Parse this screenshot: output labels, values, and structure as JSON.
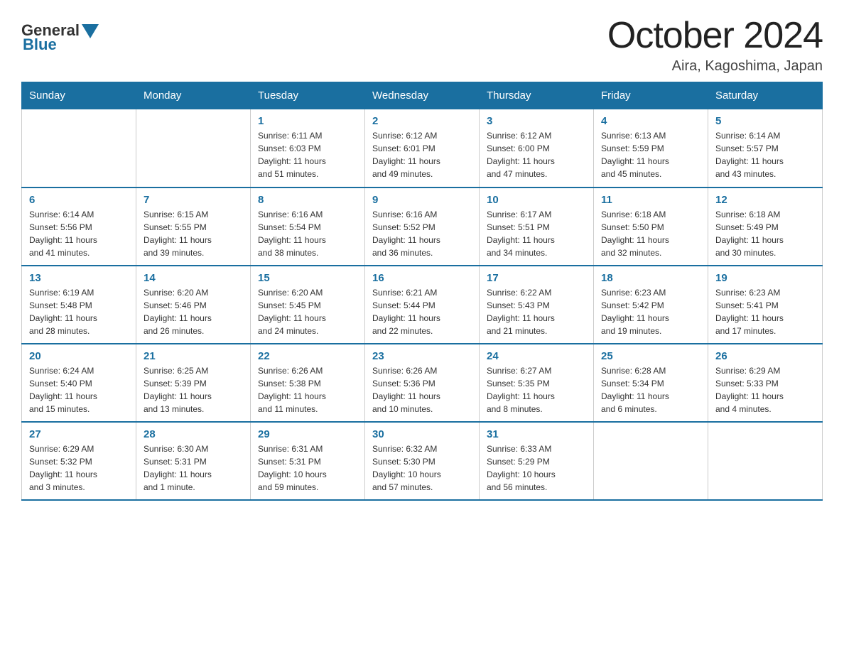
{
  "logo": {
    "general": "General",
    "blue": "Blue"
  },
  "title": "October 2024",
  "location": "Aira, Kagoshima, Japan",
  "headers": [
    "Sunday",
    "Monday",
    "Tuesday",
    "Wednesday",
    "Thursday",
    "Friday",
    "Saturday"
  ],
  "weeks": [
    [
      {
        "day": "",
        "info": ""
      },
      {
        "day": "",
        "info": ""
      },
      {
        "day": "1",
        "info": "Sunrise: 6:11 AM\nSunset: 6:03 PM\nDaylight: 11 hours\nand 51 minutes."
      },
      {
        "day": "2",
        "info": "Sunrise: 6:12 AM\nSunset: 6:01 PM\nDaylight: 11 hours\nand 49 minutes."
      },
      {
        "day": "3",
        "info": "Sunrise: 6:12 AM\nSunset: 6:00 PM\nDaylight: 11 hours\nand 47 minutes."
      },
      {
        "day": "4",
        "info": "Sunrise: 6:13 AM\nSunset: 5:59 PM\nDaylight: 11 hours\nand 45 minutes."
      },
      {
        "day": "5",
        "info": "Sunrise: 6:14 AM\nSunset: 5:57 PM\nDaylight: 11 hours\nand 43 minutes."
      }
    ],
    [
      {
        "day": "6",
        "info": "Sunrise: 6:14 AM\nSunset: 5:56 PM\nDaylight: 11 hours\nand 41 minutes."
      },
      {
        "day": "7",
        "info": "Sunrise: 6:15 AM\nSunset: 5:55 PM\nDaylight: 11 hours\nand 39 minutes."
      },
      {
        "day": "8",
        "info": "Sunrise: 6:16 AM\nSunset: 5:54 PM\nDaylight: 11 hours\nand 38 minutes."
      },
      {
        "day": "9",
        "info": "Sunrise: 6:16 AM\nSunset: 5:52 PM\nDaylight: 11 hours\nand 36 minutes."
      },
      {
        "day": "10",
        "info": "Sunrise: 6:17 AM\nSunset: 5:51 PM\nDaylight: 11 hours\nand 34 minutes."
      },
      {
        "day": "11",
        "info": "Sunrise: 6:18 AM\nSunset: 5:50 PM\nDaylight: 11 hours\nand 32 minutes."
      },
      {
        "day": "12",
        "info": "Sunrise: 6:18 AM\nSunset: 5:49 PM\nDaylight: 11 hours\nand 30 minutes."
      }
    ],
    [
      {
        "day": "13",
        "info": "Sunrise: 6:19 AM\nSunset: 5:48 PM\nDaylight: 11 hours\nand 28 minutes."
      },
      {
        "day": "14",
        "info": "Sunrise: 6:20 AM\nSunset: 5:46 PM\nDaylight: 11 hours\nand 26 minutes."
      },
      {
        "day": "15",
        "info": "Sunrise: 6:20 AM\nSunset: 5:45 PM\nDaylight: 11 hours\nand 24 minutes."
      },
      {
        "day": "16",
        "info": "Sunrise: 6:21 AM\nSunset: 5:44 PM\nDaylight: 11 hours\nand 22 minutes."
      },
      {
        "day": "17",
        "info": "Sunrise: 6:22 AM\nSunset: 5:43 PM\nDaylight: 11 hours\nand 21 minutes."
      },
      {
        "day": "18",
        "info": "Sunrise: 6:23 AM\nSunset: 5:42 PM\nDaylight: 11 hours\nand 19 minutes."
      },
      {
        "day": "19",
        "info": "Sunrise: 6:23 AM\nSunset: 5:41 PM\nDaylight: 11 hours\nand 17 minutes."
      }
    ],
    [
      {
        "day": "20",
        "info": "Sunrise: 6:24 AM\nSunset: 5:40 PM\nDaylight: 11 hours\nand 15 minutes."
      },
      {
        "day": "21",
        "info": "Sunrise: 6:25 AM\nSunset: 5:39 PM\nDaylight: 11 hours\nand 13 minutes."
      },
      {
        "day": "22",
        "info": "Sunrise: 6:26 AM\nSunset: 5:38 PM\nDaylight: 11 hours\nand 11 minutes."
      },
      {
        "day": "23",
        "info": "Sunrise: 6:26 AM\nSunset: 5:36 PM\nDaylight: 11 hours\nand 10 minutes."
      },
      {
        "day": "24",
        "info": "Sunrise: 6:27 AM\nSunset: 5:35 PM\nDaylight: 11 hours\nand 8 minutes."
      },
      {
        "day": "25",
        "info": "Sunrise: 6:28 AM\nSunset: 5:34 PM\nDaylight: 11 hours\nand 6 minutes."
      },
      {
        "day": "26",
        "info": "Sunrise: 6:29 AM\nSunset: 5:33 PM\nDaylight: 11 hours\nand 4 minutes."
      }
    ],
    [
      {
        "day": "27",
        "info": "Sunrise: 6:29 AM\nSunset: 5:32 PM\nDaylight: 11 hours\nand 3 minutes."
      },
      {
        "day": "28",
        "info": "Sunrise: 6:30 AM\nSunset: 5:31 PM\nDaylight: 11 hours\nand 1 minute."
      },
      {
        "day": "29",
        "info": "Sunrise: 6:31 AM\nSunset: 5:31 PM\nDaylight: 10 hours\nand 59 minutes."
      },
      {
        "day": "30",
        "info": "Sunrise: 6:32 AM\nSunset: 5:30 PM\nDaylight: 10 hours\nand 57 minutes."
      },
      {
        "day": "31",
        "info": "Sunrise: 6:33 AM\nSunset: 5:29 PM\nDaylight: 10 hours\nand 56 minutes."
      },
      {
        "day": "",
        "info": ""
      },
      {
        "day": "",
        "info": ""
      }
    ]
  ]
}
